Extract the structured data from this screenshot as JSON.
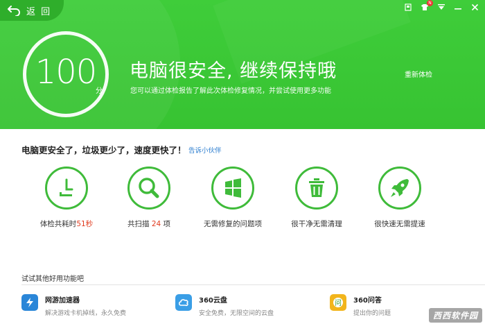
{
  "header": {
    "back_label": "返 回",
    "score": "100",
    "score_unit": "分",
    "headline": "电脑很安全, 继续保持哦",
    "subline": "您可以通过体检报告了解此次体检修复情况，并尝试使用更多功能",
    "recheck_label": "重新体检"
  },
  "window_controls": {
    "icons": [
      "skin-icon",
      "shirt-icon",
      "menu-icon",
      "minimize-icon",
      "close-icon"
    ],
    "badge": "N"
  },
  "summary": {
    "title": "电脑更安全了，垃圾更少了，速度更快了！",
    "share_link": "告诉小伙伴"
  },
  "stats": [
    {
      "icon": "clock-icon",
      "prefix": "体检共耗时",
      "value": "51秒",
      "suffix": ""
    },
    {
      "icon": "magnifier-icon",
      "prefix": "共扫描 ",
      "value": "24",
      "suffix": " 项"
    },
    {
      "icon": "windows-icon",
      "prefix": "无需修复的问题项",
      "value": "",
      "suffix": ""
    },
    {
      "icon": "trash-icon",
      "prefix": "很干净无需清理",
      "value": "",
      "suffix": ""
    },
    {
      "icon": "rocket-icon",
      "prefix": "很快速无需提速",
      "value": "",
      "suffix": ""
    }
  ],
  "more": {
    "title": "试试其他好用功能吧",
    "tools": [
      {
        "icon": "lightning-icon",
        "name": "网游加速器",
        "desc": "解决游戏卡机掉线，永久免费",
        "color": "#2a86d8"
      },
      {
        "icon": "cloud-icon",
        "name": "360云盘",
        "desc": "安全免费，无限空间的云盘",
        "color": "#3a9ee6"
      },
      {
        "icon": "question-icon",
        "name": "360问答",
        "desc": "提出你的问题",
        "color": "#f2b51c"
      }
    ]
  },
  "watermark": "西西软件园",
  "colors": {
    "brand_green": "#3fcd3a",
    "ring_green": "#3fbb3a",
    "highlight_red": "#e03a1e",
    "link_blue": "#2a7ccf"
  }
}
